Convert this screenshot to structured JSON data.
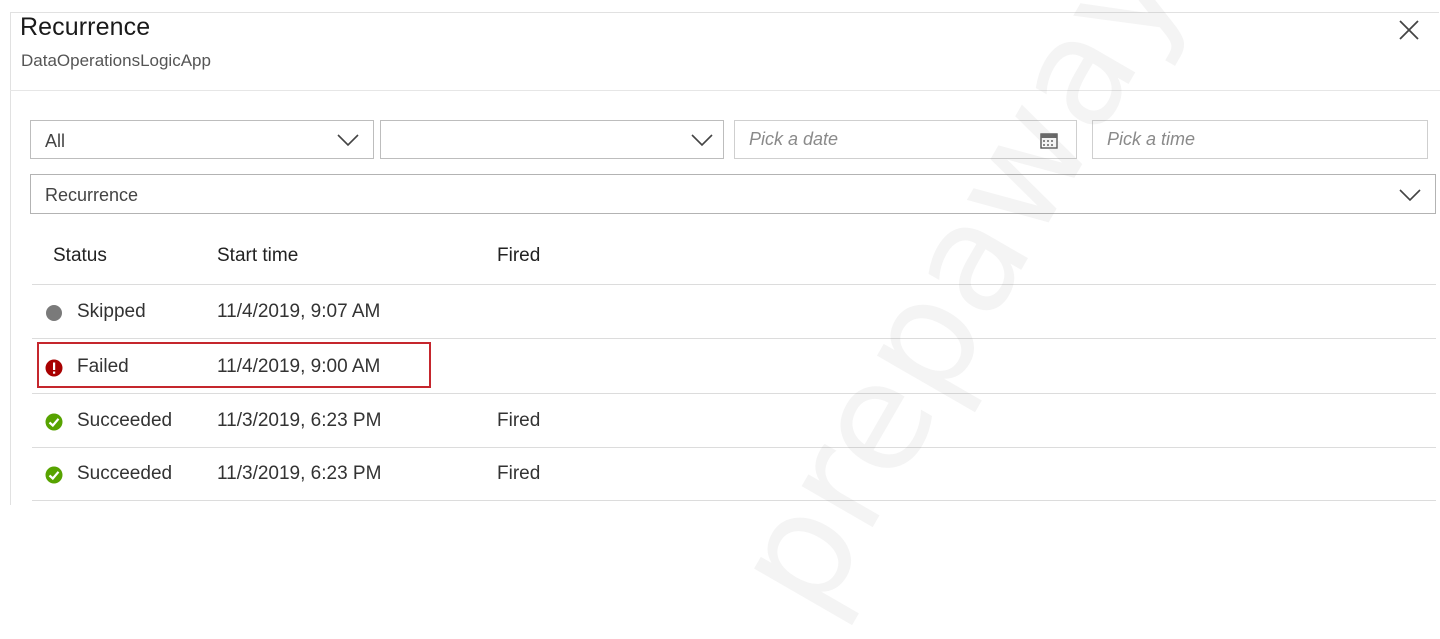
{
  "blade": {
    "title": "Recurrence",
    "subtitle": "DataOperationsLogicApp",
    "close_icon": "close-icon"
  },
  "filters": {
    "status_select": {
      "value": "All"
    },
    "second_select": {
      "value": ""
    },
    "date_picker": {
      "placeholder": "Pick a date",
      "icon": "calendar-icon"
    },
    "time_picker": {
      "placeholder": "Pick a time"
    },
    "trigger_select": {
      "value": "Recurrence"
    }
  },
  "table": {
    "columns": [
      "Status",
      "Start time",
      "Fired"
    ],
    "rows": [
      {
        "status": "Skipped",
        "status_icon": "skipped-circle-icon",
        "start_time": "11/4/2019, 9:07 AM",
        "fired": ""
      },
      {
        "status": "Failed",
        "status_icon": "error-icon",
        "start_time": "11/4/2019, 9:00 AM",
        "fired": ""
      },
      {
        "status": "Succeeded",
        "status_icon": "success-check-icon",
        "start_time": "11/3/2019, 6:23 PM",
        "fired": "Fired"
      },
      {
        "status": "Succeeded",
        "status_icon": "success-check-icon",
        "start_time": "11/3/2019, 6:23 PM",
        "fired": "Fired"
      }
    ]
  },
  "colors": {
    "skipped": "#7a7a7a",
    "failed": "#a80000",
    "succeeded": "#57a300",
    "highlight_border": "#c5262d"
  },
  "watermark": {
    "text": "prepaway"
  }
}
